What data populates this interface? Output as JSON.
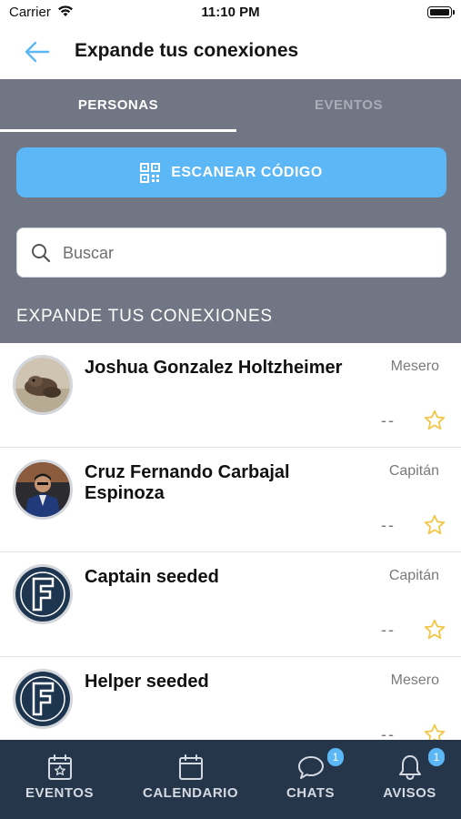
{
  "status_bar": {
    "carrier": "Carrier",
    "time": "11:10 PM"
  },
  "header": {
    "title": "Expande tus conexiones",
    "back_icon": "arrow-left-icon"
  },
  "tabs": [
    {
      "label": "PERSONAS",
      "active": true
    },
    {
      "label": "EVENTOS",
      "active": false
    }
  ],
  "scan_button": {
    "label": "ESCANEAR CÓDIGO",
    "icon": "qr-code-icon"
  },
  "search": {
    "placeholder": "Buscar",
    "value": ""
  },
  "section_title": "EXPANDE TUS CONEXIONES",
  "connections": [
    {
      "name": "Joshua Gonzalez Holtzheimer",
      "role": "Mesero",
      "rating": "--",
      "avatar": "photo"
    },
    {
      "name": "Cruz Fernando Carbajal Espinoza",
      "role": "Capitán",
      "rating": "--",
      "avatar": "photo"
    },
    {
      "name": "Captain seeded",
      "role": "Capitán",
      "rating": "--",
      "avatar": "logo-F"
    },
    {
      "name": "Helper seeded",
      "role": "Mesero",
      "rating": "--",
      "avatar": "logo-F"
    }
  ],
  "bottom_tabs": [
    {
      "label": "EVENTOS",
      "icon": "calendar-star-icon",
      "badge": ""
    },
    {
      "label": "CALENDARIO",
      "icon": "calendar-icon",
      "badge": ""
    },
    {
      "label": "CHATS",
      "icon": "chat-bubble-icon",
      "badge": "1"
    },
    {
      "label": "AVISOS",
      "icon": "bell-icon",
      "badge": "1"
    }
  ],
  "colors": {
    "accent": "#5bb7f5",
    "header_grey": "#717684",
    "tab_bar": "#25354a",
    "star": "#f4c542"
  }
}
